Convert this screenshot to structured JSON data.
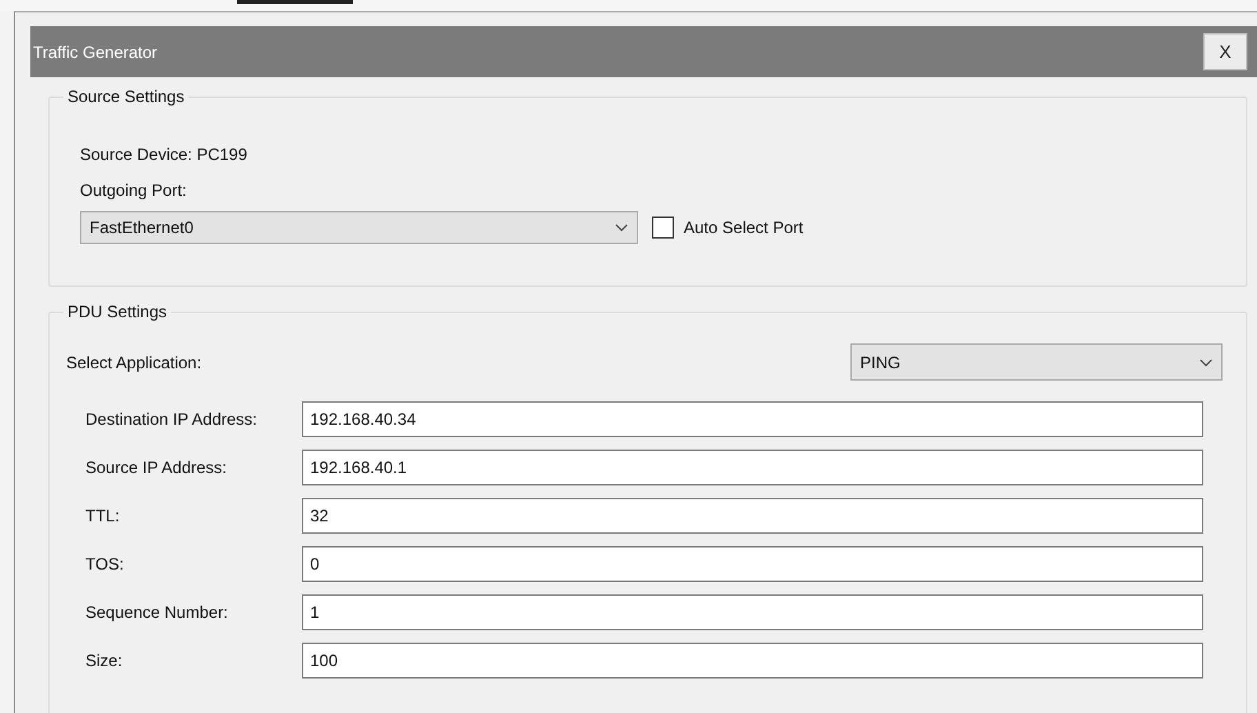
{
  "window": {
    "title": "Traffic Generator",
    "close": "X"
  },
  "source_settings": {
    "title": "Source Settings",
    "device_label": "Source Device: PC199",
    "port_label": "Outgoing Port:",
    "port_value": "FastEthernet0",
    "auto_select": {
      "label": "Auto Select Port",
      "checked": false
    }
  },
  "pdu_settings": {
    "title": "PDU Settings",
    "application_label": "Select Application:",
    "application_value": "PING",
    "fields": [
      {
        "label": "Destination IP Address:",
        "value": "192.168.40.34"
      },
      {
        "label": "Source IP Address:",
        "value": "192.168.40.1"
      },
      {
        "label": "TTL:",
        "value": "32"
      },
      {
        "label": "TOS:",
        "value": "0"
      },
      {
        "label": "Sequence Number:",
        "value": "1"
      },
      {
        "label": "Size:",
        "value": "100"
      }
    ]
  }
}
